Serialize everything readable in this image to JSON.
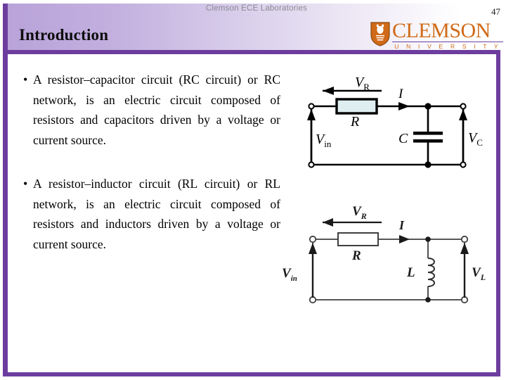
{
  "header": {
    "kicker": "Clemson ECE Laboratories",
    "title": "Introduction",
    "page_number": "47",
    "accent_purple": "#6d3d9e",
    "gradient_from": "#b9a3d9",
    "gradient_to": "#ffffff"
  },
  "logo": {
    "word": "CLEMSON",
    "subtitle": "U N I V E R S I T Y",
    "icon": "clemson-tiger-paw-shield-icon",
    "color": "#d06a18"
  },
  "bullets": [
    {
      "marker": "•",
      "text": "A resistor–capacitor circuit (RC circuit) or RC network, is an electric circuit composed of resistors and capacitors driven by a voltage or current source."
    },
    {
      "marker": "•",
      "text": "A resistor–inductor circuit (RL circuit) or RL network, is an electric circuit composed of resistors and inductors driven by a voltage or current source."
    }
  ],
  "figures": [
    {
      "id": "rc-circuit",
      "name": "rc-circuit-diagram",
      "labels": {
        "source": "V",
        "source_sub": "in",
        "resistor": "R",
        "resistor_voltage": "V",
        "resistor_voltage_sub": "R",
        "current": "I",
        "element": "C",
        "element_voltage": "V",
        "element_voltage_sub": "C"
      },
      "resistor_fill": "#dfeef0",
      "stroke": "#000000"
    },
    {
      "id": "rl-circuit",
      "name": "rl-circuit-diagram",
      "labels": {
        "source": "V",
        "source_sub": "in",
        "resistor": "R",
        "resistor_voltage": "V",
        "resistor_voltage_sub": "R",
        "current": "I",
        "element": "L",
        "element_voltage": "V",
        "element_voltage_sub": "L"
      },
      "resistor_fill": "#ffffff",
      "stroke": "#3a3a3a"
    }
  ]
}
